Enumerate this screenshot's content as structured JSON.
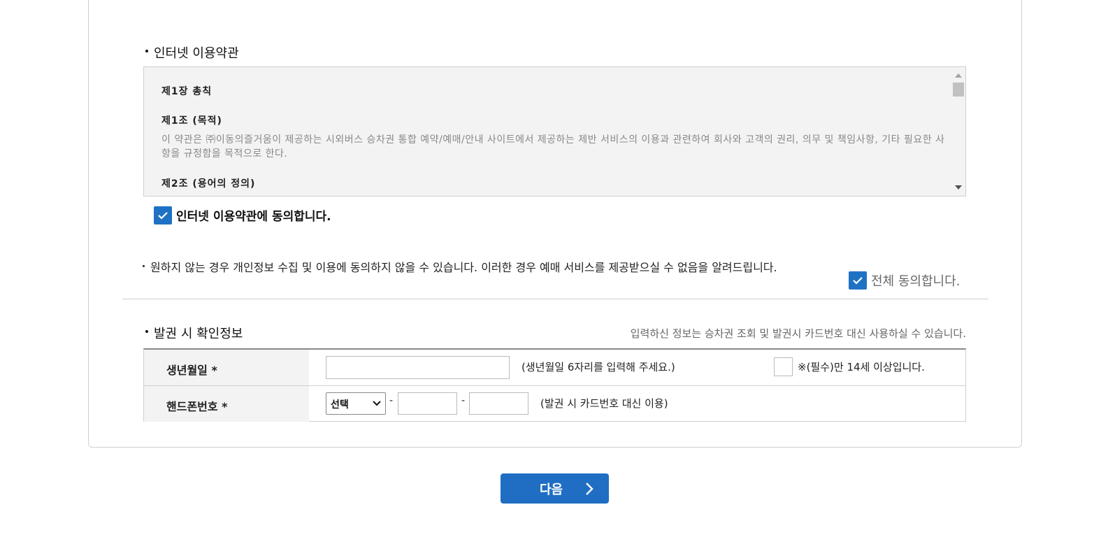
{
  "terms_section": {
    "title": "인터넷 이용약관",
    "content": [
      {
        "heading": "제1장 총칙",
        "text": ""
      },
      {
        "heading": "제1조 (목적)",
        "text": "이 약관은 ㈜이동의즐거움이 제공하는 시외버스 승차권 통합 예약/예매/안내 사이트에서 제공하는 제반 서비스의 이용과 관련하여 회사와 고객의 권리, 의무 및 책임사항, 기타 필요한 사항을 규정함을 목적으로 한다."
      },
      {
        "heading": "제2조 (용어의 정의)",
        "text": ""
      }
    ],
    "agree_label": "인터넷 이용약관에 동의합니다.",
    "agree_checked": true
  },
  "notice": "원하지 않는 경우 개인정보 수집 및 이용에 동의하지 않을 수 있습니다. 이러한 경우 예매 서비스를 제공받으실 수 없음을 알려드립니다.",
  "agree_all": {
    "label": "전체 동의합니다.",
    "checked": true
  },
  "verify_section": {
    "title": "발권 시 확인정보",
    "note": "입력하신 정보는 승차권 조회 및 발권시 카드번호 대신 사용하실 수 있습니다.",
    "birth": {
      "label": "생년월일 *",
      "value": "",
      "hint": "(생년월일 6자리를 입력해 주세요.)",
      "age_confirm": "※(필수)만 14세 이상입니다.",
      "age_checked": false
    },
    "phone": {
      "label": "핸드폰번호 *",
      "select_value": "선택",
      "dash": "-",
      "middle": "",
      "last": "",
      "hint": "(발권 시 카드번호 대신 이용)"
    }
  },
  "next_button": "다음",
  "colors": {
    "accent": "#1f6ec3",
    "checkbox": "#1f72c3"
  }
}
